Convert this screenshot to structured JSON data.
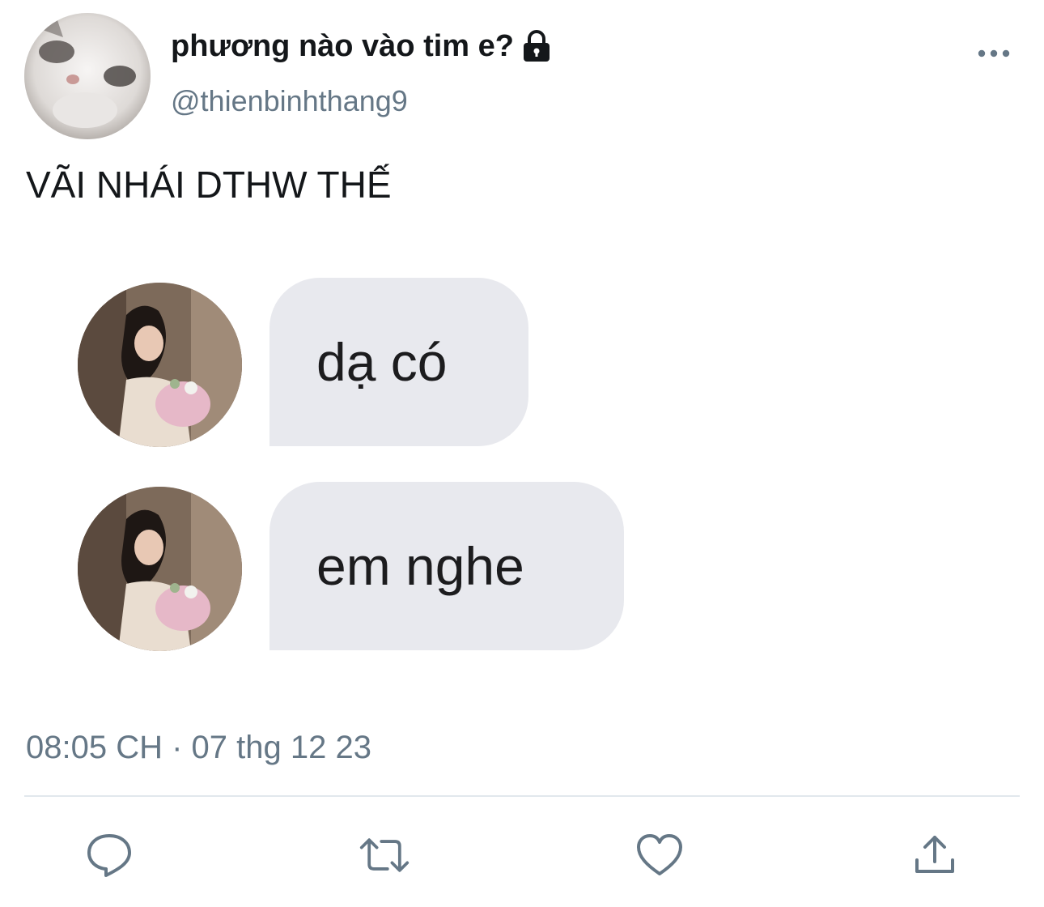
{
  "author": {
    "display_name": "phương nào vào tim e?",
    "handle": "@thienbinhthang9",
    "protected_icon": "lock-icon",
    "avatar": "cat-photo"
  },
  "tweet": {
    "text": "VÃI NHÁI DTHW THẾ",
    "timestamp": "08:05 CH · 07 thg 12 23"
  },
  "media": {
    "messages": [
      {
        "avatar": "woman-with-flowers-photo",
        "text": "dạ có"
      },
      {
        "avatar": "woman-with-flowers-photo",
        "text": "em nghe"
      }
    ]
  },
  "actions": {
    "reply_icon": "reply-icon",
    "retweet_icon": "retweet-icon",
    "like_icon": "heart-icon",
    "share_icon": "share-icon"
  },
  "colors": {
    "text_primary": "#14171a",
    "text_secondary": "#657786",
    "bubble": "#e8e9ee",
    "divider": "#e1e8ed"
  }
}
